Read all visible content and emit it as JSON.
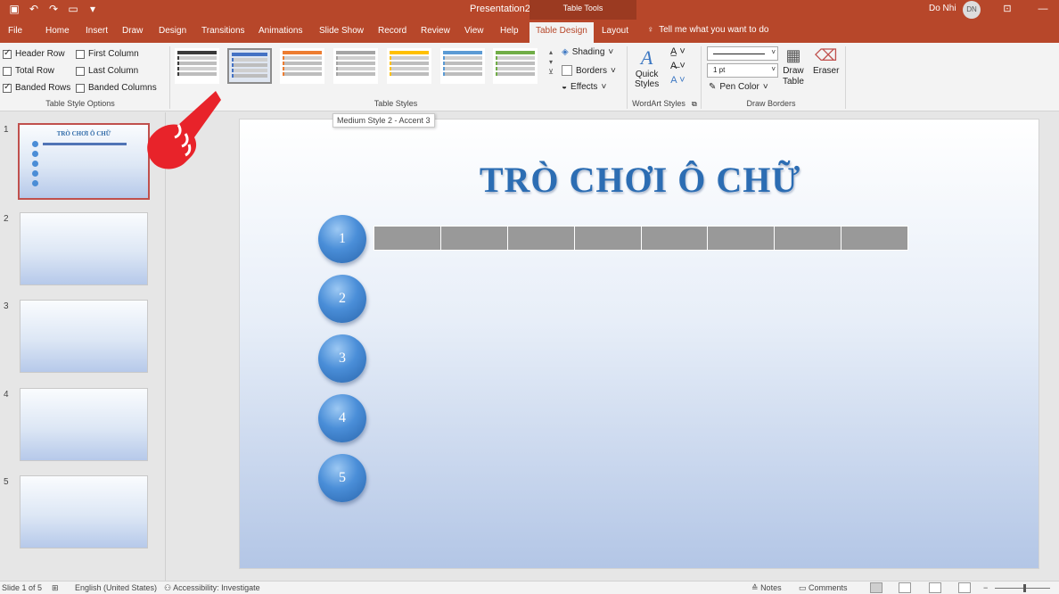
{
  "titlebar": {
    "document_title": "Presentation2  -  PowerPoint",
    "context_tab": "Table Tools",
    "user_name": "Do Nhi",
    "user_initials": "DN",
    "qat_icons": [
      "save-icon",
      "undo-icon",
      "redo-icon",
      "present-icon",
      "customize-icon"
    ],
    "colors": {
      "brand": "#b7472a"
    }
  },
  "tabs": {
    "items": [
      {
        "label": "File"
      },
      {
        "label": "Home"
      },
      {
        "label": "Insert"
      },
      {
        "label": "Draw"
      },
      {
        "label": "Design"
      },
      {
        "label": "Transitions"
      },
      {
        "label": "Animations"
      },
      {
        "label": "Slide Show"
      },
      {
        "label": "Record"
      },
      {
        "label": "Review"
      },
      {
        "label": "View"
      },
      {
        "label": "Help"
      },
      {
        "label": "Table Design",
        "active": true
      },
      {
        "label": "Layout"
      }
    ],
    "tell_me": "Tell me what you want to do"
  },
  "ribbon": {
    "style_options": {
      "header_row": "Header Row",
      "first_column": "First Column",
      "total_row": "Total Row",
      "last_column": "Last Column",
      "banded_rows": "Banded Rows",
      "banded_columns": "Banded Columns",
      "group_label": "Table Style Options"
    },
    "table_styles": {
      "group_label": "Table Styles",
      "swatch_colors": [
        "#3b3b3b",
        "#4472c4",
        "#ed7d31",
        "#a5a5a5",
        "#ffc000",
        "#5b9bd5",
        "#70ad47"
      ],
      "shading": "Shading",
      "borders": "Borders",
      "effects": "Effects"
    },
    "wordart": {
      "group_label": "WordArt Styles",
      "quick_styles": "Quick",
      "quick_styles_2": "Styles"
    },
    "draw_borders": {
      "group_label": "Draw Borders",
      "pen_weight": "1 pt",
      "pen_color": "Pen Color",
      "draw_table": "Draw",
      "draw_table_2": "Table",
      "eraser": "Eraser"
    },
    "tooltip": "Medium Style 2 - Accent 3"
  },
  "thumbnails": {
    "slides": [
      {
        "number": "1",
        "title": "TRÒ CHƠI Ô CHỮ"
      },
      {
        "number": "2"
      },
      {
        "number": "3"
      },
      {
        "number": "4"
      },
      {
        "number": "5"
      }
    ]
  },
  "slide": {
    "title": "TRÒ CHƠI Ô CHỮ",
    "numbers": [
      "1",
      "2",
      "3",
      "4",
      "5"
    ],
    "word_cell_count": 8
  },
  "status": {
    "slide_info": "Slide 1 of 5",
    "language": "English (United States)",
    "accessibility": "Accessibility: Investigate",
    "notes": "Notes",
    "comments": "Comments"
  }
}
